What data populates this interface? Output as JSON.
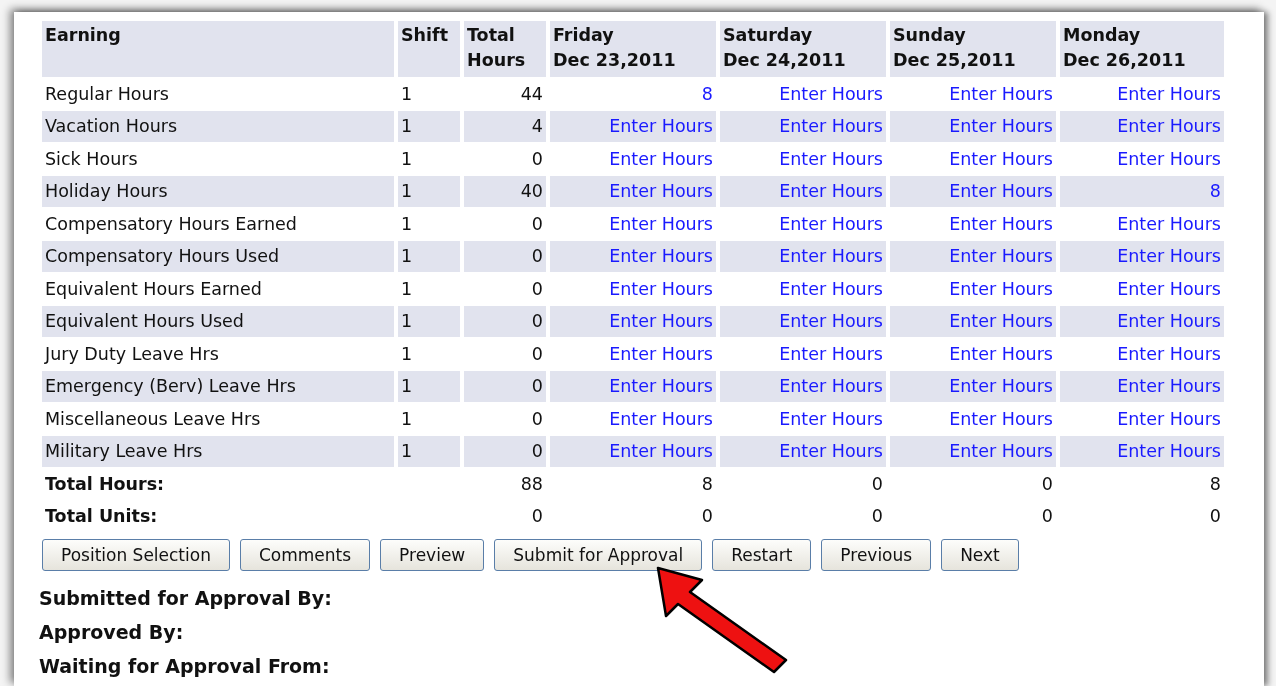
{
  "table": {
    "columns": [
      [
        "Earning"
      ],
      [
        "Shift"
      ],
      [
        "Total",
        "Hours"
      ],
      [
        "Friday",
        "Dec 23,2011"
      ],
      [
        "Saturday",
        "Dec 24,2011"
      ],
      [
        "Sunday",
        "Dec 25,2011"
      ],
      [
        "Monday",
        "Dec 26,2011"
      ]
    ],
    "rows": [
      {
        "earning": "Regular Hours",
        "shift": "1",
        "total": "44",
        "days": [
          "8",
          "Enter Hours",
          "Enter Hours",
          "Enter Hours"
        ]
      },
      {
        "earning": "Vacation Hours",
        "shift": "1",
        "total": "4",
        "days": [
          "Enter Hours",
          "Enter Hours",
          "Enter Hours",
          "Enter Hours"
        ]
      },
      {
        "earning": "Sick Hours",
        "shift": "1",
        "total": "0",
        "days": [
          "Enter Hours",
          "Enter Hours",
          "Enter Hours",
          "Enter Hours"
        ]
      },
      {
        "earning": "Holiday Hours",
        "shift": "1",
        "total": "40",
        "days": [
          "Enter Hours",
          "Enter Hours",
          "Enter Hours",
          "8"
        ]
      },
      {
        "earning": "Compensatory Hours Earned",
        "shift": "1",
        "total": "0",
        "days": [
          "Enter Hours",
          "Enter Hours",
          "Enter Hours",
          "Enter Hours"
        ]
      },
      {
        "earning": "Compensatory Hours Used",
        "shift": "1",
        "total": "0",
        "days": [
          "Enter Hours",
          "Enter Hours",
          "Enter Hours",
          "Enter Hours"
        ]
      },
      {
        "earning": "Equivalent Hours Earned",
        "shift": "1",
        "total": "0",
        "days": [
          "Enter Hours",
          "Enter Hours",
          "Enter Hours",
          "Enter Hours"
        ]
      },
      {
        "earning": "Equivalent Hours Used",
        "shift": "1",
        "total": "0",
        "days": [
          "Enter Hours",
          "Enter Hours",
          "Enter Hours",
          "Enter Hours"
        ]
      },
      {
        "earning": "Jury Duty Leave Hrs",
        "shift": "1",
        "total": "0",
        "days": [
          "Enter Hours",
          "Enter Hours",
          "Enter Hours",
          "Enter Hours"
        ]
      },
      {
        "earning": "Emergency (Berv) Leave Hrs",
        "shift": "1",
        "total": "0",
        "days": [
          "Enter Hours",
          "Enter Hours",
          "Enter Hours",
          "Enter Hours"
        ]
      },
      {
        "earning": "Miscellaneous Leave Hrs",
        "shift": "1",
        "total": "0",
        "days": [
          "Enter Hours",
          "Enter Hours",
          "Enter Hours",
          "Enter Hours"
        ]
      },
      {
        "earning": "Military Leave Hrs",
        "shift": "1",
        "total": "0",
        "days": [
          "Enter Hours",
          "Enter Hours",
          "Enter Hours",
          "Enter Hours"
        ]
      }
    ],
    "totals": [
      {
        "label": "Total Hours:",
        "total": "88",
        "days": [
          "8",
          "0",
          "0",
          "8"
        ]
      },
      {
        "label": "Total Units:",
        "total": "0",
        "days": [
          "0",
          "0",
          "0",
          "0"
        ]
      }
    ]
  },
  "buttons": [
    "Position Selection",
    "Comments",
    "Preview",
    "Submit for Approval",
    "Restart",
    "Previous",
    "Next"
  ],
  "approval": [
    "Submitted for Approval By:",
    "Approved By:",
    "Waiting for Approval From:"
  ]
}
